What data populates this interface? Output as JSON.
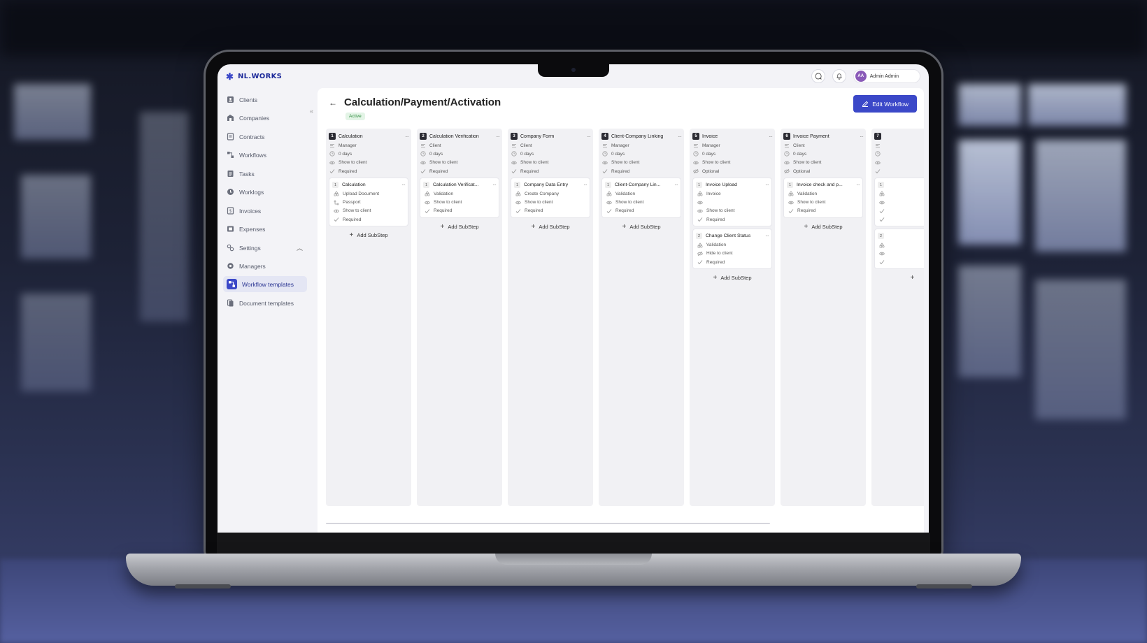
{
  "app": {
    "logo_text": "NL.WORKS",
    "user": {
      "initials": "AA",
      "name": "Admin Admin"
    }
  },
  "sidebar": {
    "items": [
      {
        "label": "Clients",
        "icon": "user-square-icon"
      },
      {
        "label": "Companies",
        "icon": "building-icon"
      },
      {
        "label": "Contracts",
        "icon": "contract-icon"
      },
      {
        "label": "Workflows",
        "icon": "workflow-icon"
      },
      {
        "label": "Tasks",
        "icon": "tasks-icon"
      },
      {
        "label": "Worklogs",
        "icon": "worklog-icon"
      },
      {
        "label": "Invoices",
        "icon": "invoice-icon"
      },
      {
        "label": "Expenses",
        "icon": "expense-icon"
      },
      {
        "label": "Settings",
        "icon": "settings-icon"
      },
      {
        "label": "Managers",
        "icon": "gear-icon"
      },
      {
        "label": "Workflow templates",
        "icon": "workflow-template-icon"
      },
      {
        "label": "Document templates",
        "icon": "document-template-icon"
      }
    ]
  },
  "page": {
    "title": "Calculation/Payment/Activation",
    "status": "Active",
    "edit_button": "Edit Workflow"
  },
  "columns": [
    {
      "number": "1",
      "title": "Calculation",
      "meta": [
        "Manager",
        "0 days",
        "Show to client",
        "Required"
      ],
      "cards": [
        {
          "number": "1",
          "title": "Calculation",
          "meta": [
            "Upload Document",
            "Passport",
            "Show to client",
            "Required"
          ]
        }
      ],
      "add_label": "Add SubStep"
    },
    {
      "number": "2",
      "title": "Calculation Verification",
      "meta": [
        "Client",
        "0 days",
        "Show to client",
        "Required"
      ],
      "cards": [
        {
          "number": "1",
          "title": "Calculation Verificat...",
          "meta": [
            "Validation",
            "Show to client",
            "Required"
          ]
        }
      ],
      "add_label": "Add SubStep"
    },
    {
      "number": "3",
      "title": "Company Form",
      "meta": [
        "Client",
        "0 days",
        "Show to client",
        "Required"
      ],
      "cards": [
        {
          "number": "1",
          "title": "Company Data Entry",
          "meta": [
            "Create Company",
            "Show to client",
            "Required"
          ]
        }
      ],
      "add_label": "Add SubStep"
    },
    {
      "number": "4",
      "title": "Client-Company Linking",
      "meta": [
        "Manager",
        "0 days",
        "Show to client",
        "Required"
      ],
      "cards": [
        {
          "number": "1",
          "title": "Client-Company Lin...",
          "meta": [
            "Validation",
            "Show to client",
            "Required"
          ]
        }
      ],
      "add_label": "Add SubStep"
    },
    {
      "number": "5",
      "title": "Invoice",
      "meta": [
        "Manager",
        "0 days",
        "Show to client",
        "Optional"
      ],
      "cards": [
        {
          "number": "1",
          "title": "Invoice Upload",
          "meta": [
            "Invoice",
            "",
            "Show to client",
            "Required"
          ]
        },
        {
          "number": "2",
          "title": "Change Client Status",
          "meta": [
            "Validation",
            "Hide to client",
            "Required"
          ]
        }
      ],
      "add_label": "Add SubStep"
    },
    {
      "number": "6",
      "title": "Invoice Payment",
      "meta": [
        "Client",
        "0 days",
        "Show to client",
        "Optional"
      ],
      "cards": [
        {
          "number": "1",
          "title": "Invoice check and p...",
          "meta": [
            "Validation",
            "Show to client",
            "Required"
          ]
        }
      ],
      "add_label": "Add SubStep"
    },
    {
      "number": "7",
      "title": "",
      "meta": [
        "",
        "",
        "",
        ""
      ],
      "cards": [
        {
          "number": "1",
          "title": "",
          "meta": [
            "",
            "",
            "",
            ""
          ]
        },
        {
          "number": "2",
          "title": "",
          "meta": [
            "",
            "",
            ""
          ]
        }
      ],
      "add_label": ""
    }
  ],
  "colors": {
    "accent": "#3b48c8",
    "active_badge_bg": "#e3f4e6",
    "active_badge_text": "#2e8b3e"
  }
}
